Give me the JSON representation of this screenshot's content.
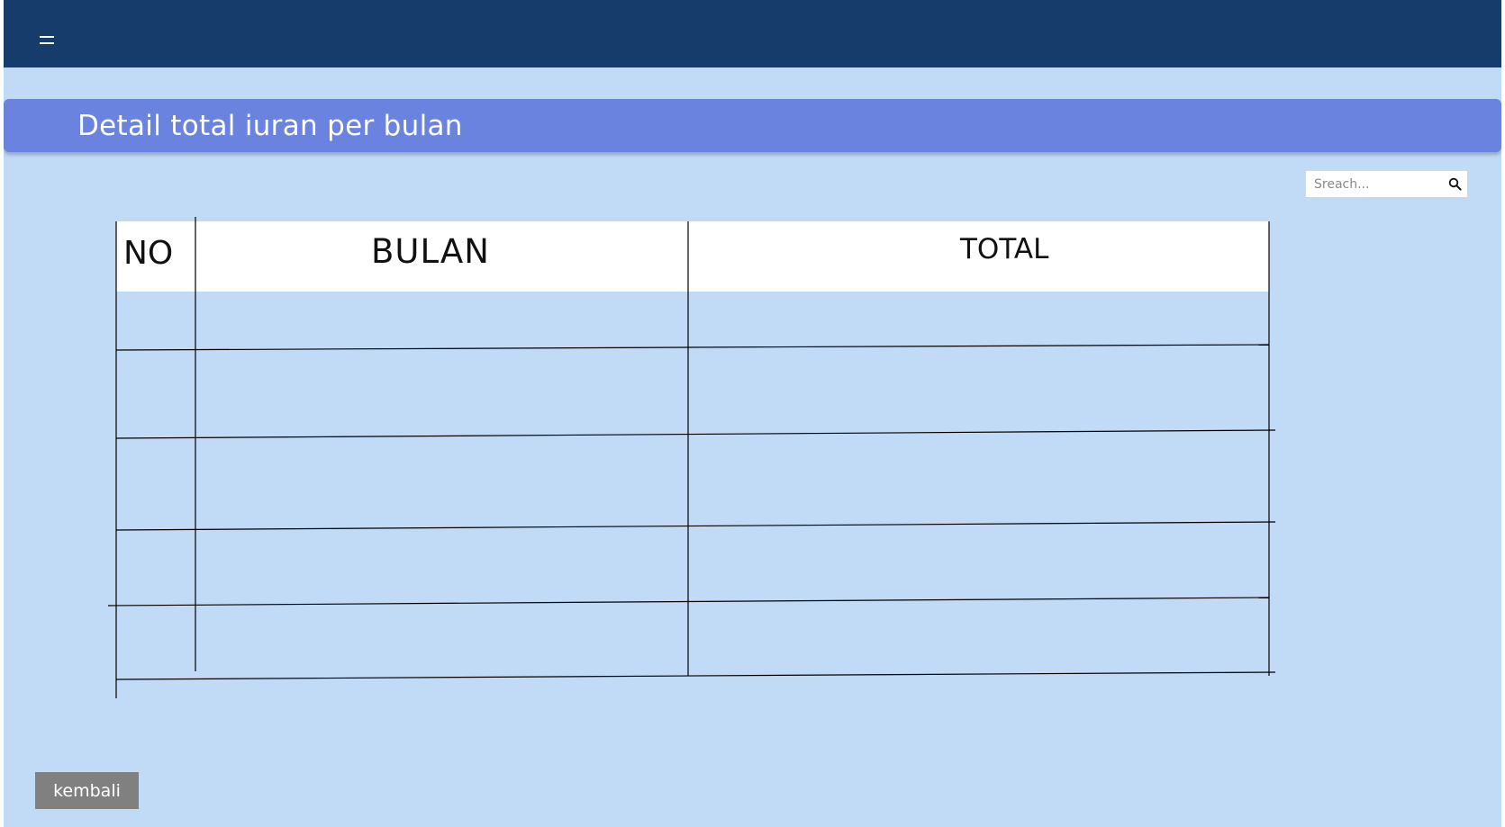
{
  "header": {
    "menu_icon": "menu-icon"
  },
  "page": {
    "title": "Detail total iuran per bulan"
  },
  "search": {
    "placeholder": "Sreach...",
    "value": "",
    "icon": "search-icon"
  },
  "table": {
    "columns": [
      "NO",
      "BULAN",
      "TOTAL"
    ],
    "rows": [
      [
        "",
        "",
        ""
      ],
      [
        "",
        "",
        ""
      ],
      [
        "",
        "",
        ""
      ],
      [
        "",
        "",
        ""
      ],
      [
        "",
        "",
        ""
      ]
    ]
  },
  "actions": {
    "back_label": "kembali"
  },
  "colors": {
    "topbar": "#153c6b",
    "background": "#c1dbf7",
    "title_bar": "#6a83df",
    "button": "#808080"
  }
}
